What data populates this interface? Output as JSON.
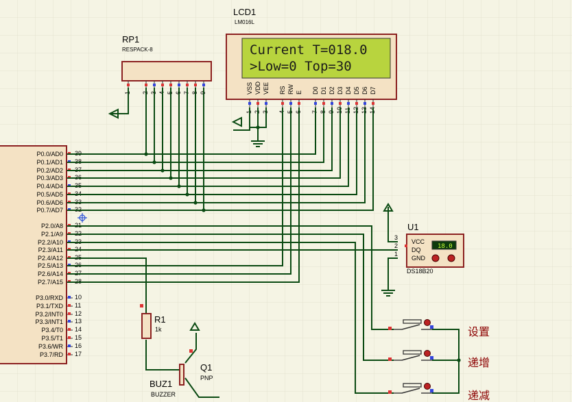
{
  "lcd": {
    "ref": "LCD1",
    "part": "LM016L",
    "line1": "Current T=018.0",
    "line2": ">Low=0   Top=30",
    "pins": [
      {
        "num": "1",
        "name": "VSS"
      },
      {
        "num": "2",
        "name": "VDD"
      },
      {
        "num": "3",
        "name": "VEE"
      },
      {
        "num": "4",
        "name": "RS"
      },
      {
        "num": "5",
        "name": "RW"
      },
      {
        "num": "6",
        "name": "E"
      },
      {
        "num": "7",
        "name": "D0"
      },
      {
        "num": "8",
        "name": "D1"
      },
      {
        "num": "9",
        "name": "D2"
      },
      {
        "num": "10",
        "name": "D3"
      },
      {
        "num": "11",
        "name": "D4"
      },
      {
        "num": "12",
        "name": "D5"
      },
      {
        "num": "13",
        "name": "D6"
      },
      {
        "num": "14",
        "name": "D7"
      }
    ]
  },
  "rp": {
    "ref": "RP1",
    "part": "RESPACK-8",
    "pins": [
      "1",
      "2",
      "3",
      "4",
      "5",
      "6",
      "7",
      "8",
      "9"
    ]
  },
  "mcu": {
    "pins": [
      {
        "name": "P0.0/AD0",
        "num": "39"
      },
      {
        "name": "P0.1/AD1",
        "num": "38"
      },
      {
        "name": "P0.2/AD2",
        "num": "37"
      },
      {
        "name": "P0.3/AD3",
        "num": "36"
      },
      {
        "name": "P0.4/AD4",
        "num": "35"
      },
      {
        "name": "P0.5/AD5",
        "num": "34"
      },
      {
        "name": "P0.6/AD6",
        "num": "33"
      },
      {
        "name": "P0.7/AD7",
        "num": "32"
      },
      {
        "name": "P2.0/A8",
        "num": "21"
      },
      {
        "name": "P2.1/A9",
        "num": "22"
      },
      {
        "name": "P2.2/A10",
        "num": "23"
      },
      {
        "name": "P2.3/A11",
        "num": "24"
      },
      {
        "name": "P2.4/A12",
        "num": "25"
      },
      {
        "name": "P2.5/A13",
        "num": "26"
      },
      {
        "name": "P2.6/A14",
        "num": "27"
      },
      {
        "name": "P2.7/A15",
        "num": "28"
      },
      {
        "name": "P3.0/RXD",
        "num": "10"
      },
      {
        "name": "P3.1/TXD",
        "num": "11"
      },
      {
        "name": "P3.2/INT0",
        "num": "12"
      },
      {
        "name": "P3.3/INT1",
        "num": "13"
      },
      {
        "name": "P3.4/T0",
        "num": "14"
      },
      {
        "name": "P3.5/T1",
        "num": "15"
      },
      {
        "name": "P3.6/WR",
        "num": "16"
      },
      {
        "name": "P3.7/RD",
        "num": "17"
      }
    ]
  },
  "ds18b20": {
    "ref": "U1",
    "part": "DS18B20",
    "reading": "18.0",
    "pins": [
      {
        "num": "3",
        "name": "VCC"
      },
      {
        "num": "2",
        "name": "DQ"
      },
      {
        "num": "1",
        "name": "GND"
      }
    ]
  },
  "keys": [
    {
      "label": "设置"
    },
    {
      "label": "递增"
    },
    {
      "label": "递减"
    }
  ],
  "resistor": {
    "ref": "R1",
    "value": "1k"
  },
  "transistor": {
    "ref": "Q1",
    "type": "PNP"
  },
  "buzzer": {
    "ref": "BUZ1",
    "part": "BUZZER"
  },
  "colors": {
    "wire": "#0a4a12",
    "body_fill": "#f4e2c4",
    "body_stroke": "#8b2020",
    "lcd_screen": "#b8d43e",
    "pin_red": "#dd3333",
    "pin_blue": "#3344dd"
  }
}
